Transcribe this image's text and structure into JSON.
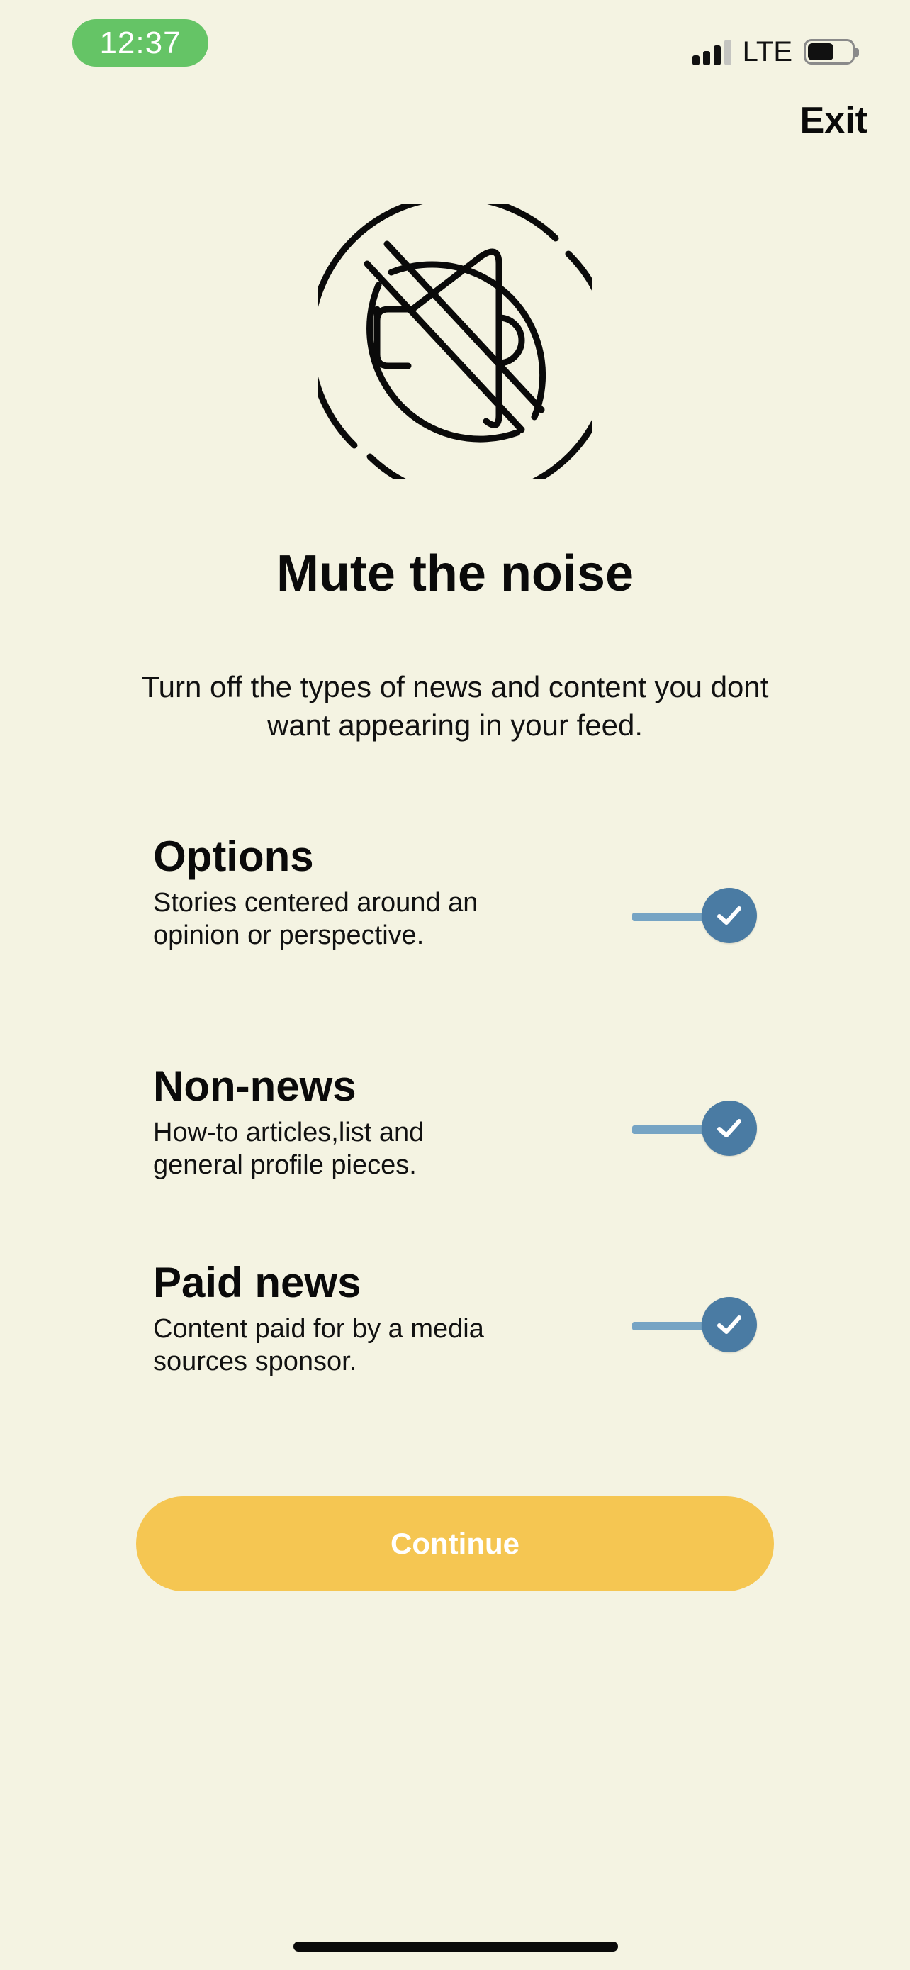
{
  "status_bar": {
    "time": "12:37",
    "network": "LTE",
    "battery_level": 0.6,
    "signal_bars": 3
  },
  "header": {
    "exit_label": "Exit"
  },
  "hero": {
    "icon": "mute-speaker-icon",
    "title": "Mute the noise",
    "subtitle": "Turn off the types of news and content you dont want appearing in your feed."
  },
  "options": [
    {
      "title": "Options",
      "description": "Stories centered around an opinion or perspective.",
      "enabled": true
    },
    {
      "title": "Non-news",
      "description": "How-to articles,list and general profile pieces.",
      "enabled": true
    },
    {
      "title": "Paid news",
      "description": "Content paid for by a media sources sponsor.",
      "enabled": true
    }
  ],
  "footer": {
    "continue_label": "Continue"
  },
  "colors": {
    "background": "#f4f3e2",
    "time_pill": "#65c466",
    "toggle_knob": "#4a7ba3",
    "toggle_track": "#76a4c4",
    "continue_button": "#f5c652"
  }
}
